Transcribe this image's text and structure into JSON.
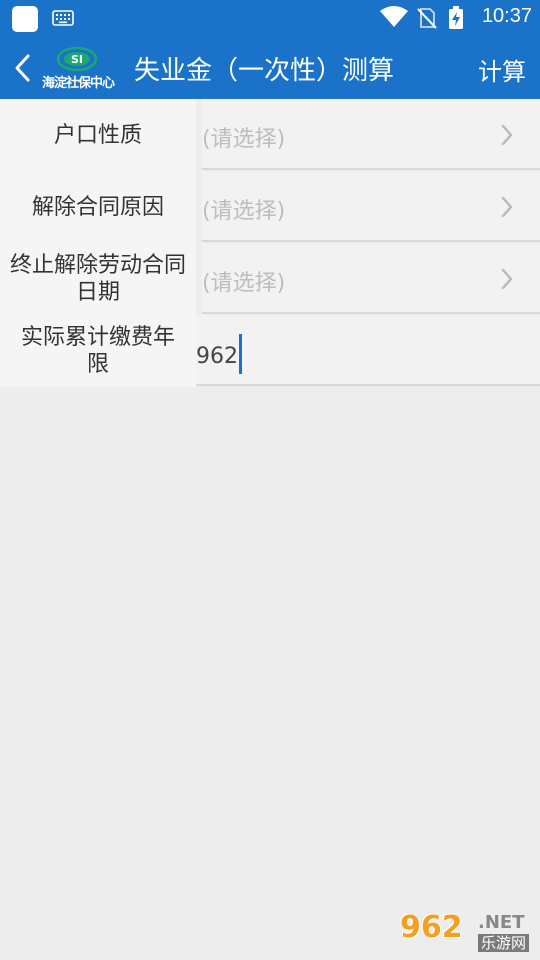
{
  "status_bar": {
    "time": "10:37",
    "icons": [
      "app-icon",
      "keyboard-icon",
      "wifi-icon",
      "no-sim-icon",
      "battery-charging-icon"
    ]
  },
  "header": {
    "logo_text": "海淀社保中心",
    "title": "失业金（一次性）测算",
    "calc_label": "计算",
    "back_icon": "back-chevron-icon",
    "colors": {
      "bar": "#1a73c8",
      "text": "#ffffff"
    }
  },
  "form": {
    "rows": [
      {
        "label_lines": [
          "户口性质"
        ],
        "placeholder": "(请选择)"
      },
      {
        "label_lines": [
          "解除合同原因"
        ],
        "placeholder": "(请选择)"
      },
      {
        "label_lines": [
          "终止解除劳动合同",
          "日期"
        ],
        "placeholder": "(请选择)"
      },
      {
        "label_lines": [
          "实际累计缴费年",
          "限"
        ],
        "value": "962"
      }
    ]
  },
  "watermark": {
    "main": "962",
    "suffix": ".NET",
    "sub": "乐游网"
  }
}
